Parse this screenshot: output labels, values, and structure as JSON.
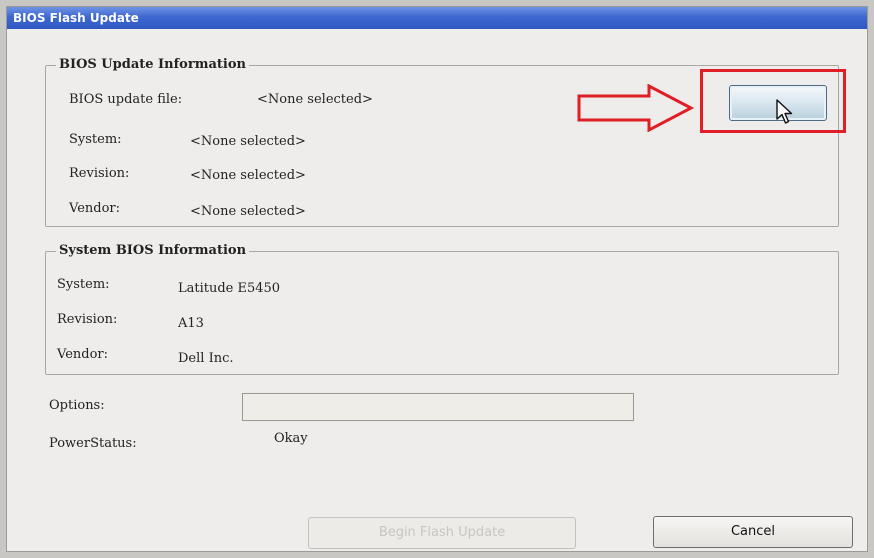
{
  "window": {
    "title": "BIOS Flash Update"
  },
  "update_info": {
    "legend": "BIOS Update Information",
    "file_label": "BIOS update file:",
    "file_value": "<None selected>",
    "system_label": "System:",
    "system_value": "<None selected>",
    "revision_label": "Revision:",
    "revision_value": "<None selected>",
    "vendor_label": "Vendor:",
    "vendor_value": "<None selected>"
  },
  "system_info": {
    "legend": "System BIOS Information",
    "system_label": "System:",
    "system_value": "Latitude E5450",
    "revision_label": "Revision:",
    "revision_value": "A13",
    "vendor_label": "Vendor:",
    "vendor_value": "Dell Inc."
  },
  "options": {
    "label": "Options:",
    "value": ""
  },
  "power": {
    "label": "PowerStatus:",
    "value": "Okay"
  },
  "buttons": {
    "begin": "Begin Flash Update",
    "cancel": "Cancel"
  },
  "annotation": {
    "highlight_color": "#e01e25",
    "arrow_icon": "right-arrow-outline",
    "cursor_icon": "mouse-pointer"
  }
}
